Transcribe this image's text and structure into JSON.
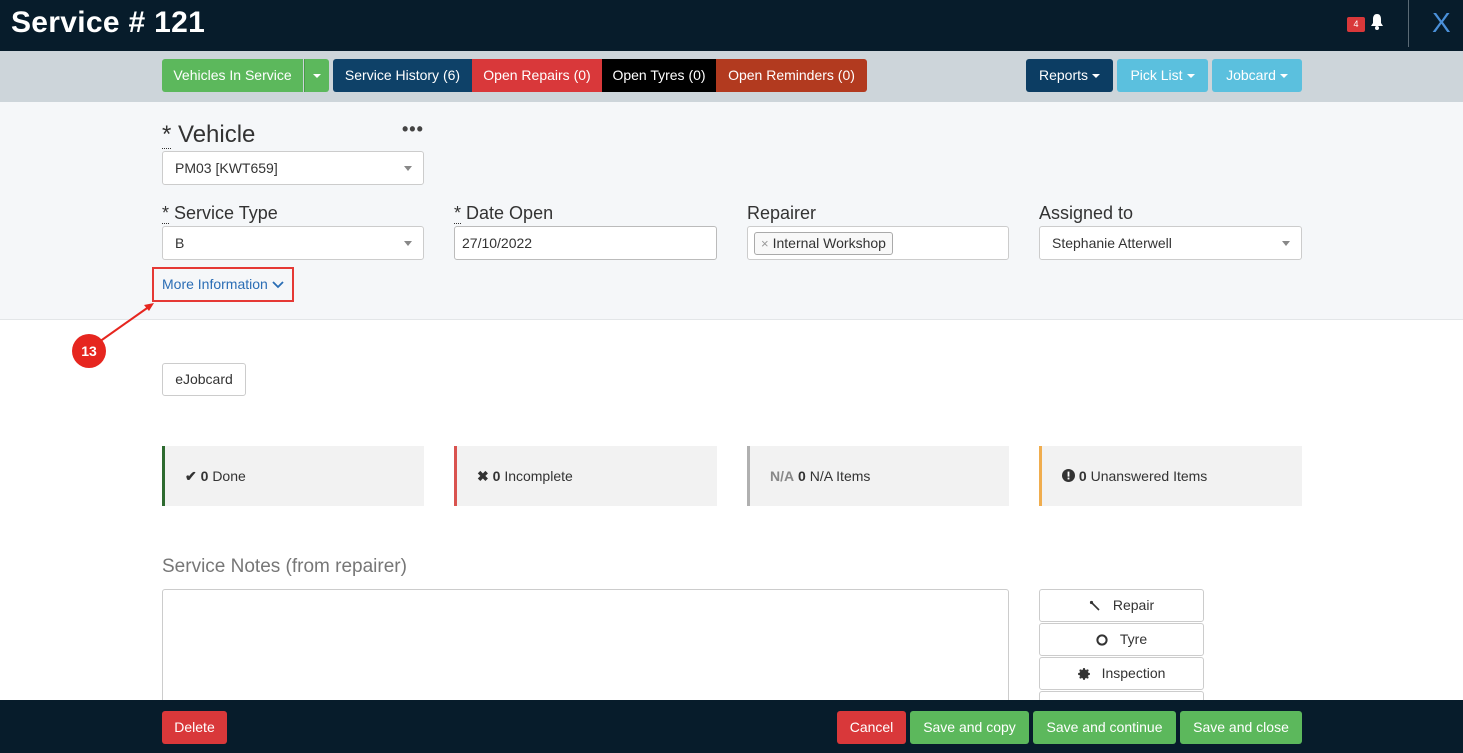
{
  "window": {
    "title": "Service # 121",
    "notification_count": "4",
    "close_label": "X"
  },
  "toolbar": {
    "vehicles_in_service": "Vehicles In Service",
    "service_history": "Service History (6)",
    "open_repairs": "Open Repairs (0)",
    "open_tyres": "Open Tyres (0)",
    "open_reminders": "Open Reminders (0)",
    "reports": "Reports",
    "pick_list": "Pick List",
    "jobcard": "Jobcard"
  },
  "form": {
    "vehicle_label": "Vehicle",
    "required_mark": "*",
    "vehicle_value": "PM03 [KWT659]",
    "more_dots": "•••",
    "service_type_label": "Service Type",
    "service_type_value": "B",
    "date_open_label": "Date Open",
    "date_open_value": "27/10/2022",
    "repairer_label": "Repairer",
    "repairer_tag": "Internal Workshop",
    "repairer_tag_remove": "×",
    "assigned_to_label": "Assigned to",
    "assigned_to_value": "Stephanie Atterwell",
    "more_information": "More Information"
  },
  "annotation": {
    "step_number": "13"
  },
  "ejobcard_label": "eJobcard",
  "status": {
    "done_count": "0",
    "done_label": "Done",
    "incomplete_count": "0",
    "incomplete_label": "Incomplete",
    "na_prefix": "N/A",
    "na_count": "0",
    "na_label": "N/A Items",
    "unanswered_count": "0",
    "unanswered_label": "Unanswered Items"
  },
  "notes": {
    "label": "Service Notes (from repairer)"
  },
  "side_actions": {
    "repair": "Repair",
    "tyre": "Tyre",
    "inspection": "Inspection"
  },
  "footer": {
    "delete": "Delete",
    "cancel": "Cancel",
    "save_copy": "Save and copy",
    "save_continue": "Save and continue",
    "save_close": "Save and close"
  },
  "colors": {
    "titlebar": "#071c2b",
    "green": "#5cb85c",
    "navy": "#0e4168",
    "red": "#d9383a",
    "black": "#000000",
    "brown": "#b23a1f",
    "dark_blue": "#0c3d63",
    "light_blue": "#5bc0de",
    "tile_done": "#2e6b30",
    "tile_incomplete": "#d9534f",
    "tile_na": "#b0b0b0",
    "tile_unanswered": "#f0ad4e"
  }
}
